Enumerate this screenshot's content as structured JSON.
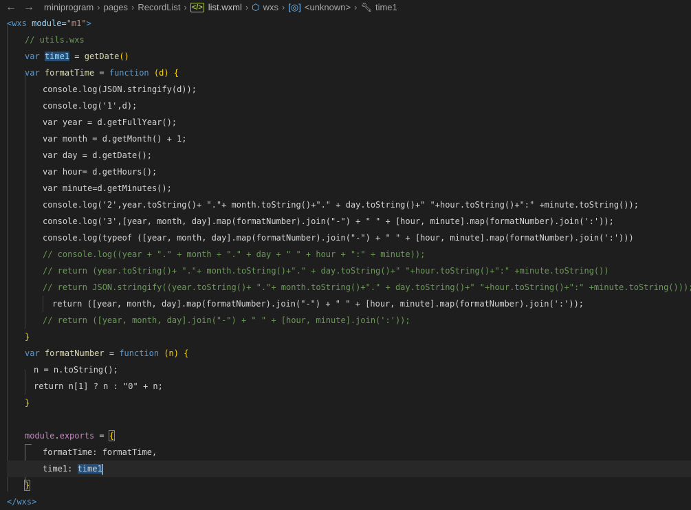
{
  "breadcrumb": {
    "back_icon": "←",
    "forward_icon": "→",
    "items": [
      "miniprogram",
      "pages",
      "RecordList",
      "list.wxml",
      "wxs",
      "<unknown>",
      "time1"
    ],
    "file_icon": "&lt;/&gt;"
  },
  "code": {
    "l1a": "<wxs",
    "l1b": " module=",
    "l1c": "\"m1\"",
    "l1d": ">",
    "l2": "// utils.wxs",
    "l3a": "var",
    "l3b": "time1",
    "l3c": " = ",
    "l3d": "getDate",
    "l3e": "()",
    "l4a": "var",
    "l4b": "formatTime",
    "l4c": " = ",
    "l4d": "function",
    "l4e": " (d) {",
    "l5": "console.log(JSON.stringify(d));",
    "l6": "console.log('1',d);",
    "l7": "var year = d.getFullYear();",
    "l8": "var month = d.getMonth() + 1;",
    "l9": "var day = d.getDate();",
    "l10": "var hour= d.getHours();",
    "l11": "var minute=d.getMinutes();",
    "l12": "console.log('2',year.toString()+ \".\"+ month.toString()+\".\" + day.toString()+\" \"+hour.toString()+\":\" +minute.toString());",
    "l13": "console.log('3',[year, month, day].map(formatNumber).join(\"-\") + \" \" + [hour, minute].map(formatNumber).join(':'));",
    "l14": "console.log(typeof ([year, month, day].map(formatNumber).join(\"-\") + \" \" + [hour, minute].map(formatNumber).join(':')))",
    "l15": "// console.log((year + \".\" + month + \".\" + day + \" \" + hour + \":\" + minute));",
    "l16": "// return (year.toString()+ \".\"+ month.toString()+\".\" + day.toString()+\" \"+hour.toString()+\":\" +minute.toString())",
    "l17": "// return JSON.stringify((year.toString()+ \".\"+ month.toString()+\".\" + day.toString()+\" \"+hour.toString()+\":\" +minute.toString()));",
    "l18": "return ([year, month, day].map(formatNumber).join(\"-\") + \" \" + [hour, minute].map(formatNumber).join(':'));",
    "l19": "// return ([year, month, day].join(\"-\") + \" \" + [hour, minute].join(':'));",
    "l20": "}",
    "l21a": "var",
    "l21b": "formatNumber",
    "l21c": " = ",
    "l21d": "function",
    "l21e": " (n) {",
    "l22": "n = n.toString();",
    "l23": "return n[1] ? n : \"0\" + n;",
    "l24": "}",
    "l26a": "module",
    "l26b": ".",
    "l26c": "exports",
    "l26d": " = ",
    "l26e": "{",
    "l27a": "formatTime",
    "l27b": ": ",
    "l27c": "formatTime",
    "l27d": ",",
    "l28a": "time1",
    "l28b": ": ",
    "l28c": "time1",
    "l29": "}",
    "l30a": "</",
    "l30b": "wxs",
    "l30c": ">"
  }
}
